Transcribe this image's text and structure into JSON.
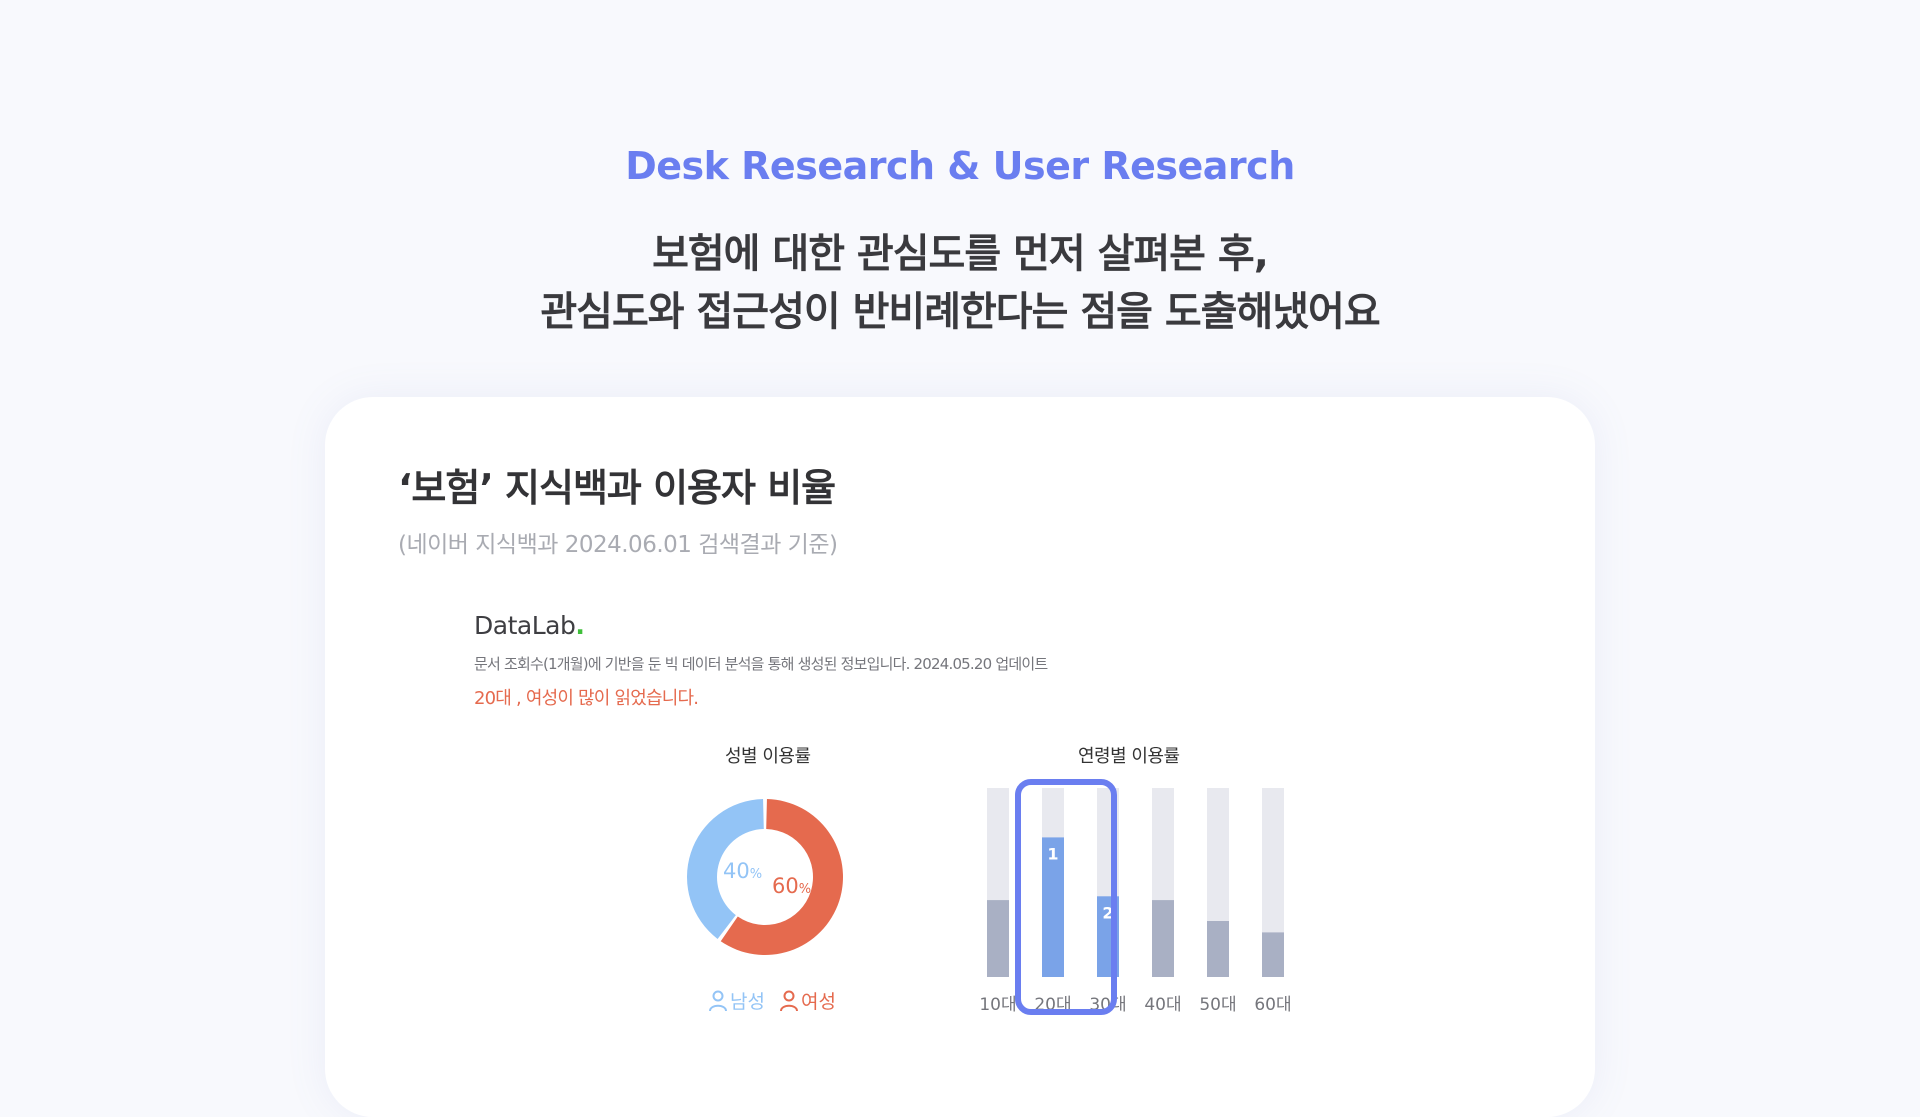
{
  "header": {
    "eyebrow": "Desk Research & User Research",
    "headline_line1": "보험에 대한 관심도를 먼저 살펴본 후,",
    "headline_line2": "관심도와 접근성이 반비례한다는 점을 도출해냈어요"
  },
  "card": {
    "title": "‘보험’ 지식백과 이용자 비율",
    "subtitle": "(네이버 지식백과 2024.06.01 검색결과 기준)",
    "datalab": {
      "logo_text": "DataLab",
      "logo_dot": ".",
      "description": "문서 조회수(1개월)에 기반을 둔 빅 데이터 분석을 통해 생성된 정보입니다. 2024.05.20 업데이트",
      "highlight": "20대 , 여성이 많이 읽었습니다."
    }
  },
  "chart_data": [
    {
      "type": "pie",
      "title": "성별 이용률",
      "categories": [
        "남성",
        "여성"
      ],
      "values": [
        40,
        60
      ],
      "labels": [
        "40",
        "60"
      ],
      "unit": "%",
      "colors": [
        "#93c4f6",
        "#e56a4e"
      ],
      "legend": "bottom"
    },
    {
      "type": "bar",
      "title": "연령별 이용률",
      "categories": [
        "10대",
        "20대",
        "30대",
        "40대",
        "50대",
        "60대"
      ],
      "values": [
        41,
        74,
        43,
        41,
        30,
        24
      ],
      "ylim": [
        0,
        100
      ],
      "rank_labels": [
        "",
        "1",
        "2",
        "",
        "",
        ""
      ],
      "highlighted": [
        "20대",
        "30대"
      ],
      "colors": {
        "track": "#e8e9ef",
        "bar": "#a9b0c4",
        "highlight": "#7aa3e8",
        "focus": "#6a7ef0"
      }
    }
  ]
}
